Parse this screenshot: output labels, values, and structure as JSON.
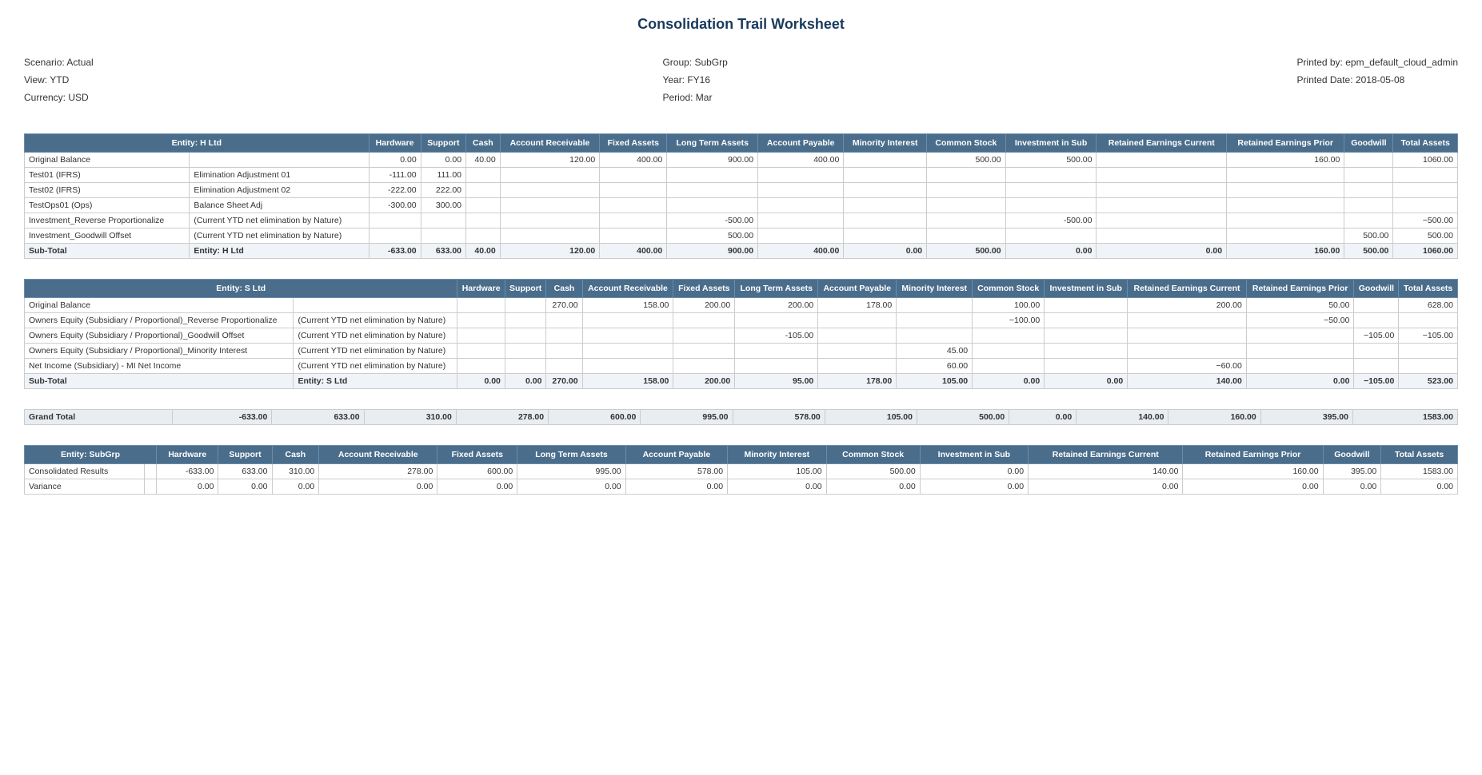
{
  "title": "Consolidation Trail Worksheet",
  "meta": {
    "scenario_label": "Scenario: Actual",
    "view_label": "View: YTD",
    "currency_label": "Currency: USD",
    "group_label": "Group: SubGrp",
    "year_label": "Year: FY16",
    "period_label": "Period: Mar",
    "printed_by_label": "Printed by: epm_default_cloud_admin",
    "printed_date_label": "Printed Date: 2018-05-08"
  },
  "tables": [
    {
      "entity": "Entity: H Ltd",
      "columns": [
        "Hardware",
        "Support",
        "Cash",
        "Account Receivable",
        "Fixed Assets",
        "Long Term Assets",
        "Account Payable",
        "Minority Interest",
        "Common Stock",
        "Investment in Sub",
        "Retained Earnings Current",
        "Retained Earnings Prior",
        "Goodwill",
        "Total Assets"
      ],
      "rows": [
        {
          "label": "Original Balance",
          "label2": "",
          "vals": [
            "0.00",
            "0.00",
            "40.00",
            "120.00",
            "400.00",
            "900.00",
            "400.00",
            "",
            "500.00",
            "500.00",
            "",
            "160.00",
            "",
            "1060.00"
          ]
        },
        {
          "label": "Test01 (IFRS)",
          "label2": "Elimination Adjustment 01",
          "vals": [
            "-111.00",
            "111.00",
            "",
            "",
            "",
            "",
            "",
            "",
            "",
            "",
            "",
            "",
            "",
            ""
          ]
        },
        {
          "label": "Test02 (IFRS)",
          "label2": "Elimination Adjustment 02",
          "vals": [
            "-222.00",
            "222.00",
            "",
            "",
            "",
            "",
            "",
            "",
            "",
            "",
            "",
            "",
            "",
            ""
          ]
        },
        {
          "label": "TestOps01 (Ops)",
          "label2": "Balance Sheet Adj",
          "vals": [
            "-300.00",
            "300.00",
            "",
            "",
            "",
            "",
            "",
            "",
            "",
            "",
            "",
            "",
            "",
            ""
          ]
        },
        {
          "label": "Investment_Reverse Proportionalize",
          "label2": "(Current YTD net elimination by Nature)",
          "vals": [
            "",
            "",
            "",
            "",
            "",
            "-500.00",
            "",
            "",
            "",
            "-500.00",
            "",
            "",
            "",
            "−500.00"
          ]
        },
        {
          "label": "Investment_Goodwill Offset",
          "label2": "(Current YTD net elimination by Nature)",
          "vals": [
            "",
            "",
            "",
            "",
            "",
            "500.00",
            "",
            "",
            "",
            "",
            "",
            "",
            "500.00",
            "500.00"
          ]
        }
      ],
      "subtotal": {
        "label": "Sub-Total",
        "entity": "Entity: H Ltd",
        "vals": [
          "-633.00",
          "633.00",
          "40.00",
          "120.00",
          "400.00",
          "900.00",
          "400.00",
          "0.00",
          "500.00",
          "0.00",
          "0.00",
          "160.00",
          "500.00",
          "1060.00"
        ]
      }
    },
    {
      "entity": "Entity: S Ltd",
      "columns": [
        "Hardware",
        "Support",
        "Cash",
        "Account Receivable",
        "Fixed Assets",
        "Long Term Assets",
        "Account Payable",
        "Minority Interest",
        "Common Stock",
        "Investment in Sub",
        "Retained Earnings Current",
        "Retained Earnings Prior",
        "Goodwill",
        "Total Assets"
      ],
      "rows": [
        {
          "label": "Original Balance",
          "label2": "",
          "vals": [
            "",
            "",
            "270.00",
            "158.00",
            "200.00",
            "200.00",
            "178.00",
            "",
            "100.00",
            "",
            "200.00",
            "50.00",
            "",
            "628.00"
          ]
        },
        {
          "label": "Owners Equity (Subsidiary / Proportional)_Reverse Proportionalize",
          "label2": "(Current YTD net elimination by Nature)",
          "vals": [
            "",
            "",
            "",
            "",
            "",
            "",
            "",
            "",
            "−100.00",
            "",
            "",
            "−50.00",
            "",
            ""
          ]
        },
        {
          "label": "Owners Equity (Subsidiary / Proportional)_Goodwill Offset",
          "label2": "(Current YTD net elimination by Nature)",
          "vals": [
            "",
            "",
            "",
            "",
            "",
            "-105.00",
            "",
            "",
            "",
            "",
            "",
            "",
            "−105.00",
            "−105.00"
          ]
        },
        {
          "label": "Owners Equity (Subsidiary / Proportional)_Minority Interest",
          "label2": "(Current YTD net elimination by Nature)",
          "vals": [
            "",
            "",
            "",
            "",
            "",
            "",
            "",
            "45.00",
            "",
            "",
            "",
            "",
            "",
            ""
          ]
        },
        {
          "label": "Net Income (Subsidiary) - MI Net Income",
          "label2": "(Current YTD net elimination by Nature)",
          "vals": [
            "",
            "",
            "",
            "",
            "",
            "",
            "",
            "60.00",
            "",
            "",
            "−60.00",
            "",
            "",
            ""
          ]
        }
      ],
      "subtotal": {
        "label": "Sub-Total",
        "entity": "Entity: S Ltd",
        "vals": [
          "0.00",
          "0.00",
          "270.00",
          "158.00",
          "200.00",
          "95.00",
          "178.00",
          "105.00",
          "0.00",
          "0.00",
          "140.00",
          "0.00",
          "−105.00",
          "523.00"
        ]
      }
    }
  ],
  "grandtotal": {
    "label": "Grand Total",
    "vals": [
      "-633.00",
      "633.00",
      "310.00",
      "278.00",
      "600.00",
      "995.00",
      "578.00",
      "105.00",
      "500.00",
      "0.00",
      "140.00",
      "160.00",
      "395.00",
      "1583.00"
    ]
  },
  "summary_table": {
    "entity": "Entity: SubGrp",
    "columns": [
      "Hardware",
      "Support",
      "Cash",
      "Account Receivable",
      "Fixed Assets",
      "Long Term Assets",
      "Account Payable",
      "Minority Interest",
      "Common Stock",
      "Investment in Sub",
      "Retained Earnings Current",
      "Retained Earnings Prior",
      "Goodwill",
      "Total Assets"
    ],
    "rows": [
      {
        "label": "Consolidated Results",
        "label2": "",
        "vals": [
          "-633.00",
          "633.00",
          "310.00",
          "278.00",
          "600.00",
          "995.00",
          "578.00",
          "105.00",
          "500.00",
          "0.00",
          "140.00",
          "160.00",
          "395.00",
          "1583.00"
        ]
      },
      {
        "label": "Variance",
        "label2": "",
        "vals": [
          "0.00",
          "0.00",
          "0.00",
          "0.00",
          "0.00",
          "0.00",
          "0.00",
          "0.00",
          "0.00",
          "0.00",
          "0.00",
          "0.00",
          "0.00",
          "0.00"
        ]
      }
    ]
  }
}
